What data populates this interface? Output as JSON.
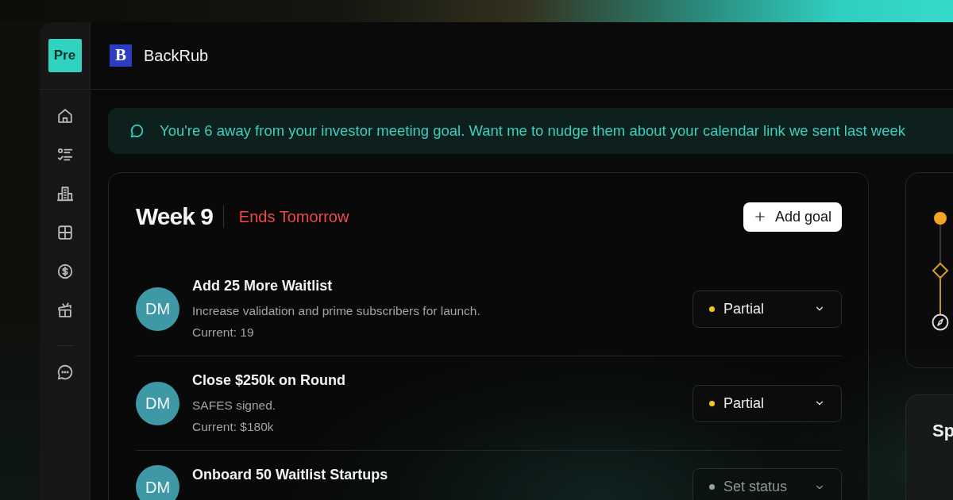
{
  "sidebar": {
    "logo": "Pre"
  },
  "header": {
    "logo": "B",
    "title": "BackRub"
  },
  "banner": {
    "text": "You're 6 away from your investor meeting goal. Want me to nudge them about your calendar link we sent last week"
  },
  "week": {
    "title": "Week 9",
    "deadline": "Ends Tomorrow",
    "add_button": "Add goal"
  },
  "goals": [
    {
      "avatar": "DM",
      "title": "Add 25 More Waitlist",
      "description": "Increase validation and prime subscribers for launch.",
      "current": "Current: 19",
      "status": {
        "value": "Partial",
        "color": "#f5c518"
      }
    },
    {
      "avatar": "DM",
      "title": "Close $250k on Round",
      "description": "SAFES signed.",
      "current": "Current: $180k",
      "status": {
        "value": "Partial",
        "color": "#f5c518"
      }
    },
    {
      "avatar": "DM",
      "title": "Onboard 50 Waitlist Startups",
      "status": {
        "placeholder": "Set status",
        "color": "#8fa39f"
      }
    }
  ],
  "side_card": {
    "title": "Sp"
  }
}
